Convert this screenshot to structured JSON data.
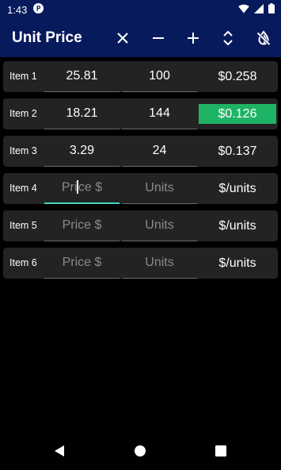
{
  "status_bar": {
    "time": "1:43",
    "notification_icon": "p-badge-icon",
    "icons": [
      "wifi-icon",
      "signal-icon",
      "battery-icon"
    ]
  },
  "app_bar": {
    "title": "Unit Price",
    "background": "#071a5c",
    "actions": [
      "close-icon",
      "minus-icon",
      "plus-icon",
      "unfold-icon",
      "invert-colors-off-icon"
    ]
  },
  "accent_color": "#3fd7c2",
  "best_color": "#1fb365",
  "items": [
    {
      "label": "Item 1",
      "price": "25.81",
      "units": "100",
      "unit_price": "$0.258",
      "best": false
    },
    {
      "label": "Item 2",
      "price": "18.21",
      "units": "144",
      "unit_price": "$0.126",
      "best": true
    },
    {
      "label": "Item 3",
      "price": "3.29",
      "units": "24",
      "unit_price": "$0.137",
      "best": false
    },
    {
      "label": "Item 4",
      "price": "",
      "units": "",
      "unit_price": "$/units",
      "best": false,
      "focused": true
    },
    {
      "label": "Item 5",
      "price": "",
      "units": "",
      "unit_price": "$/units",
      "best": false
    },
    {
      "label": "Item 6",
      "price": "",
      "units": "",
      "unit_price": "$/units",
      "best": false
    }
  ],
  "placeholders": {
    "price": "Price $",
    "units": "Units"
  },
  "nav_bar": [
    "back-icon",
    "home-icon",
    "recents-icon"
  ]
}
